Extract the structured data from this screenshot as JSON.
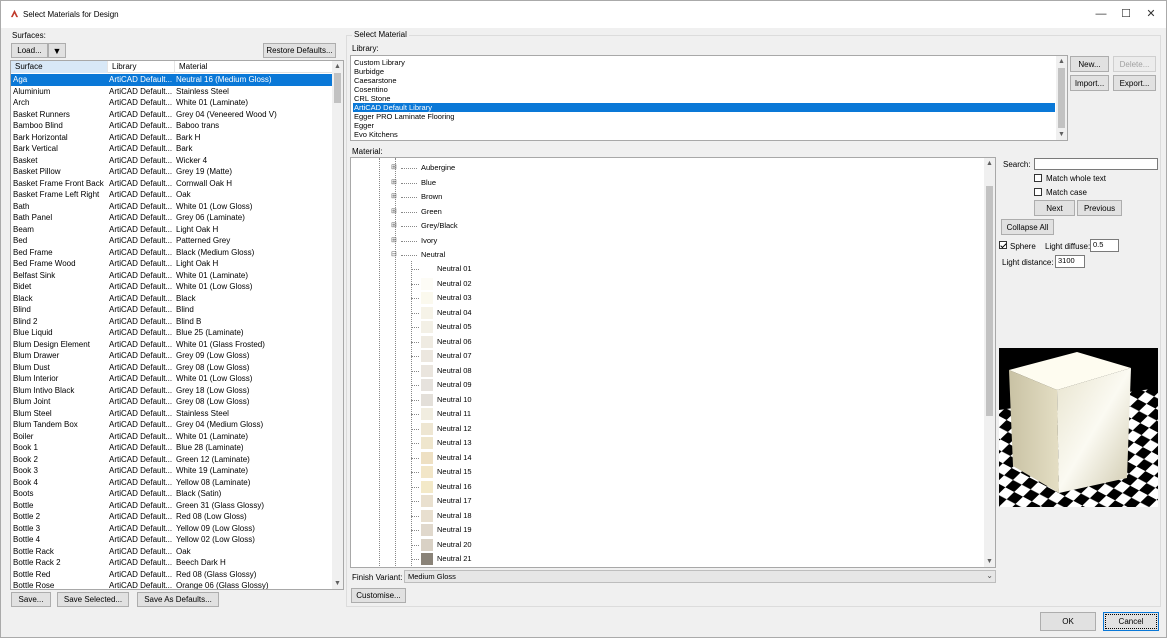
{
  "window": {
    "title": "Select Materials for Design",
    "minimize_glyph": "—",
    "maximize_glyph": "☐",
    "close_glyph": "✕"
  },
  "surfaces": {
    "label": "Surfaces:",
    "load_label": "Load...",
    "load_menu_glyph": "▼",
    "restore_label": "Restore Defaults...",
    "columns": [
      "Surface",
      "Library",
      "Material"
    ],
    "rows": [
      [
        "Aga",
        "ArtiCAD Default...",
        "Neutral 16 (Medium Gloss)"
      ],
      [
        "Aluminium",
        "ArtiCAD Default...",
        "Stainless Steel"
      ],
      [
        "Arch",
        "ArtiCAD Default...",
        "White 01 (Laminate)"
      ],
      [
        "Basket Runners",
        "ArtiCAD Default...",
        "Grey 04 (Veneered Wood V)"
      ],
      [
        "Bamboo Blind",
        "ArtiCAD Default...",
        "Baboo trans"
      ],
      [
        "Bark Horizontal",
        "ArtiCAD Default...",
        "Bark H"
      ],
      [
        "Bark Vertical",
        "ArtiCAD Default...",
        "Bark"
      ],
      [
        "Basket",
        "ArtiCAD Default...",
        "Wicker 4"
      ],
      [
        "Basket Pillow",
        "ArtiCAD Default...",
        "Grey 19 (Matte)"
      ],
      [
        "Basket Frame Front Back",
        "ArtiCAD Default...",
        "Cornwall Oak H"
      ],
      [
        "Basket Frame Left Right",
        "ArtiCAD Default...",
        "Oak"
      ],
      [
        "Bath",
        "ArtiCAD Default...",
        "White 01 (Low Gloss)"
      ],
      [
        "Bath Panel",
        "ArtiCAD Default...",
        "Grey 06 (Laminate)"
      ],
      [
        "Beam",
        "ArtiCAD Default...",
        "Light Oak H"
      ],
      [
        "Bed",
        "ArtiCAD Default...",
        "Patterned Grey"
      ],
      [
        "Bed Frame",
        "ArtiCAD Default...",
        "Black (Medium Gloss)"
      ],
      [
        "Bed Frame Wood",
        "ArtiCAD Default...",
        "Light Oak H"
      ],
      [
        "Belfast Sink",
        "ArtiCAD Default...",
        "White 01 (Laminate)"
      ],
      [
        "Bidet",
        "ArtiCAD Default...",
        "White 01 (Low Gloss)"
      ],
      [
        "Black",
        "ArtiCAD Default...",
        "Black"
      ],
      [
        "Blind",
        "ArtiCAD Default...",
        "Blind"
      ],
      [
        "Blind 2",
        "ArtiCAD Default...",
        "Blind B"
      ],
      [
        "Blue Liquid",
        "ArtiCAD Default...",
        "Blue 25 (Laminate)"
      ],
      [
        "Blum Design Element",
        "ArtiCAD Default...",
        "White 01 (Glass Frosted)"
      ],
      [
        "Blum Drawer",
        "ArtiCAD Default...",
        "Grey 09 (Low Gloss)"
      ],
      [
        "Blum Dust",
        "ArtiCAD Default...",
        "Grey 08 (Low Gloss)"
      ],
      [
        "Blum Interior",
        "ArtiCAD Default...",
        "White 01 (Low Gloss)"
      ],
      [
        "Blum Intivo Black",
        "ArtiCAD Default...",
        "Grey 18 (Low Gloss)"
      ],
      [
        "Blum Joint",
        "ArtiCAD Default...",
        "Grey 08 (Low Gloss)"
      ],
      [
        "Blum Steel",
        "ArtiCAD Default...",
        "Stainless Steel"
      ],
      [
        "Blum Tandem Box",
        "ArtiCAD Default...",
        "Grey 04 (Medium Gloss)"
      ],
      [
        "Boiler",
        "ArtiCAD Default...",
        "White 01 (Laminate)"
      ],
      [
        "Book 1",
        "ArtiCAD Default...",
        "Blue 28 (Laminate)"
      ],
      [
        "Book 2",
        "ArtiCAD Default...",
        "Green 12 (Laminate)"
      ],
      [
        "Book 3",
        "ArtiCAD Default...",
        "White 19 (Laminate)"
      ],
      [
        "Book 4",
        "ArtiCAD Default...",
        "Yellow 08 (Laminate)"
      ],
      [
        "Boots",
        "ArtiCAD Default...",
        "Black (Satin)"
      ],
      [
        "Bottle",
        "ArtiCAD Default...",
        "Green 31 (Glass Glossy)"
      ],
      [
        "Bottle 2",
        "ArtiCAD Default...",
        "Red 08 (Low Gloss)"
      ],
      [
        "Bottle 3",
        "ArtiCAD Default...",
        "Yellow 09 (Low Gloss)"
      ],
      [
        "Bottle 4",
        "ArtiCAD Default...",
        "Yellow 02 (Low Gloss)"
      ],
      [
        "Bottle Rack",
        "ArtiCAD Default...",
        "Oak"
      ],
      [
        "Bottle Rack 2",
        "ArtiCAD Default...",
        "Beech Dark H"
      ],
      [
        "Bottle Red",
        "ArtiCAD Default...",
        "Red 08 (Glass Glossy)"
      ],
      [
        "Bottle Rose",
        "ArtiCAD Default...",
        "Orange 06 (Glass Glossy)"
      ]
    ],
    "save_label": "Save...",
    "save_selected_label": "Save Selected...",
    "save_defaults_label": "Save As Defaults..."
  },
  "select_material": {
    "group_label": "Select Material",
    "library_label": "Library:",
    "libraries": [
      "Custom Library",
      "Burbidge",
      "Caesarstone",
      "Cosentino",
      "CRL Stone",
      "ArtiCAD Default Library",
      "Egger PRO Laminate Flooring",
      "Egger",
      "Evo Kitchens"
    ],
    "new_label": "New...",
    "delete_label": "Delete...",
    "import_label": "Import...",
    "export_label": "Export...",
    "material_label": "Material:",
    "categories": [
      "Aubergine",
      "Blue",
      "Brown",
      "Green",
      "Grey/Black",
      "Ivory",
      "Neutral"
    ],
    "neutral_items": [
      {
        "name": "Neutral 01",
        "color": "#ffffff"
      },
      {
        "name": "Neutral 02",
        "color": "#fdfcf6"
      },
      {
        "name": "Neutral 03",
        "color": "#fbf9ee"
      },
      {
        "name": "Neutral 04",
        "color": "#f6f3e8"
      },
      {
        "name": "Neutral 05",
        "color": "#f3f0e6"
      },
      {
        "name": "Neutral 06",
        "color": "#efebe2"
      },
      {
        "name": "Neutral 07",
        "color": "#ece7df"
      },
      {
        "name": "Neutral 08",
        "color": "#eae5de"
      },
      {
        "name": "Neutral 09",
        "color": "#e6e2dd"
      },
      {
        "name": "Neutral 10",
        "color": "#e3dfd9"
      },
      {
        "name": "Neutral 11",
        "color": "#f1ede0"
      },
      {
        "name": "Neutral 12",
        "color": "#eee6d2"
      },
      {
        "name": "Neutral 13",
        "color": "#efe6cd"
      },
      {
        "name": "Neutral 14",
        "color": "#eee0c3"
      },
      {
        "name": "Neutral 15",
        "color": "#f2e6c8"
      },
      {
        "name": "Neutral 16",
        "color": "#f3e9c8"
      },
      {
        "name": "Neutral 17",
        "color": "#e9e0cf"
      },
      {
        "name": "Neutral 18",
        "color": "#e8dfcf"
      },
      {
        "name": "Neutral 19",
        "color": "#e0d8cc"
      },
      {
        "name": "Neutral 20",
        "color": "#d9d1c5"
      },
      {
        "name": "Neutral 21",
        "color": "#8a8378"
      }
    ],
    "finish_label": "Finish Variant:",
    "finish_value": "Medium Gloss",
    "customise_label": "Customise..."
  },
  "search": {
    "label": "Search:",
    "value": "",
    "match_whole_label": "Match whole text",
    "match_case_label": "Match case",
    "next_label": "Next",
    "previous_label": "Previous",
    "collapse_label": "Collapse All"
  },
  "preview": {
    "sphere_label": "Sphere",
    "sphere_checked": true,
    "light_diffuse_label": "Light diffuse:",
    "light_diffuse_value": "0.5",
    "light_distance_label": "Light distance:",
    "light_distance_value": "3100"
  },
  "footer": {
    "ok_label": "OK",
    "cancel_label": "Cancel"
  }
}
